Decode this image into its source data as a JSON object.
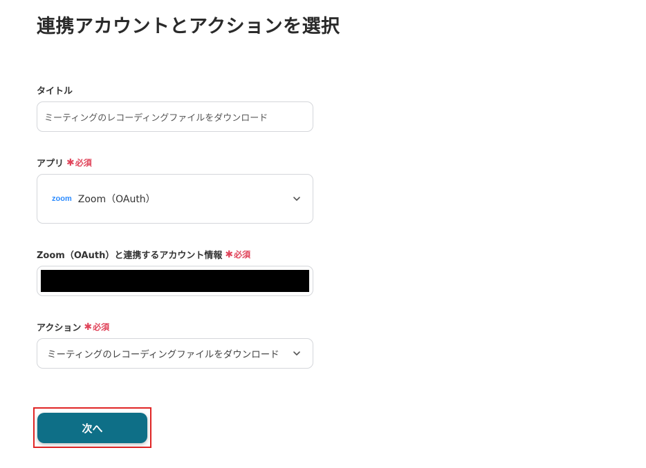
{
  "page": {
    "title": "連携アカウントとアクションを選択"
  },
  "form": {
    "title_field": {
      "label": "タイトル",
      "value": "ミーティングのレコーディングファイルをダウンロード"
    },
    "app_field": {
      "label": "アプリ",
      "required_mark": "✱",
      "required_text": "必須",
      "logo_text": "zoom",
      "value": "Zoom（OAuth）"
    },
    "account_field": {
      "label": "Zoom（OAuth）と連携するアカウント情報",
      "required_mark": "✱",
      "required_text": "必須"
    },
    "action_field": {
      "label": "アクション",
      "required_mark": "✱",
      "required_text": "必須",
      "value": "ミーティングのレコーディングファイルをダウンロード"
    }
  },
  "next_button": {
    "label": "次へ"
  },
  "colors": {
    "primary": "#0e6f87",
    "required": "#e0445a",
    "highlight": "#e02424",
    "zoom_brand": "#2d8cff"
  },
  "icons": {
    "app_dropdown": "chevron-down-icon",
    "action_dropdown": "chevron-down-icon"
  }
}
